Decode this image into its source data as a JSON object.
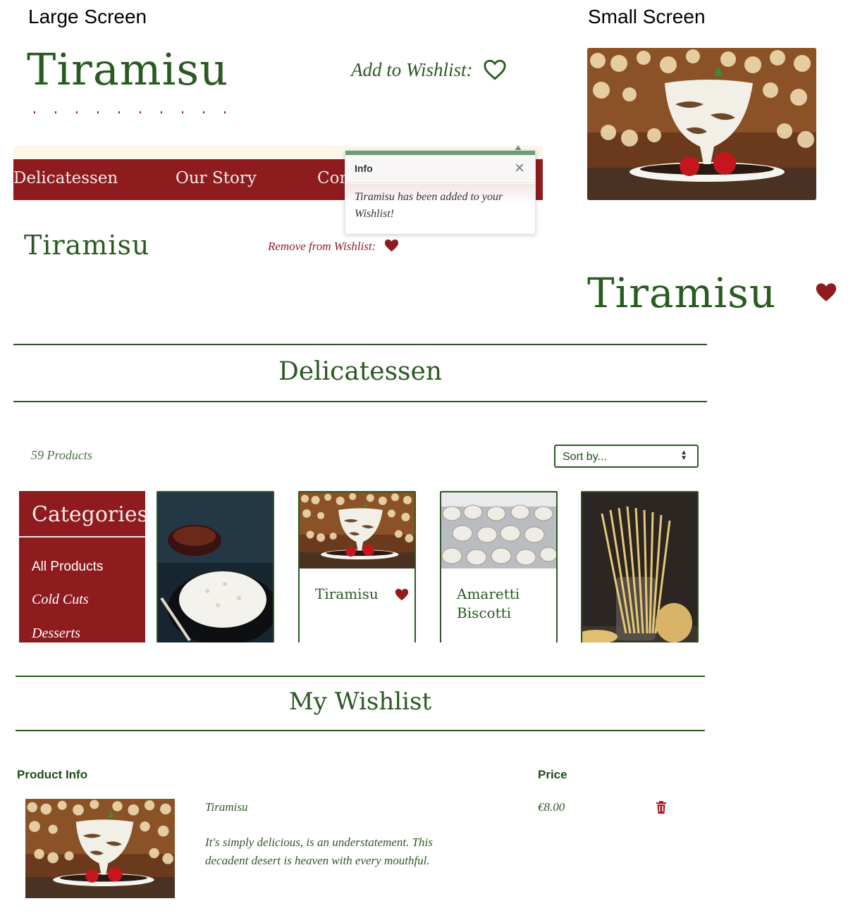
{
  "labels": {
    "large_screen": "Large Screen",
    "small_screen": "Small Screen"
  },
  "large": {
    "title": "Tiramisu",
    "add_wishlist": "Add to Wishlist:",
    "nav": [
      "Delicatessen",
      "Our Story",
      "Con"
    ],
    "toast": {
      "title": "Info",
      "close": "×",
      "message_line1": "Tiramisu has been added to your",
      "message_line2": "Wishlist!"
    },
    "secondary_title": "Tiramisu",
    "remove_wishlist": "Remove from Wishlist:"
  },
  "small": {
    "title": "Tiramisu"
  },
  "delicatessen": {
    "title": "Delicatessen",
    "count": "59 Products",
    "sort_placeholder": "Sort by...",
    "categories_title": "Categories",
    "categories": [
      "All Products",
      "Cold Cuts",
      "Desserts"
    ],
    "cards": [
      {
        "title": ""
      },
      {
        "title": "Tiramisu"
      },
      {
        "title_line1": "Amaretti",
        "title_line2": "Biscotti"
      },
      {
        "title": ""
      }
    ]
  },
  "wishlist": {
    "title": "My Wishlist",
    "col_product": "Product Info",
    "col_price": "Price",
    "item": {
      "name": "Tiramisu",
      "desc_line1": "It's simply delicious, is an understatement. This",
      "desc_line2": "decadent desert is heaven with every mouthful.",
      "price": "€8.00"
    }
  },
  "colors": {
    "brand_green": "#2a5a22",
    "brand_red": "#8e1c1f",
    "toast_accent": "#6f9a73"
  },
  "icons": [
    "heart-outline-icon",
    "heart-filled-icon",
    "close-icon",
    "sort-caret-icon",
    "trash-icon"
  ]
}
